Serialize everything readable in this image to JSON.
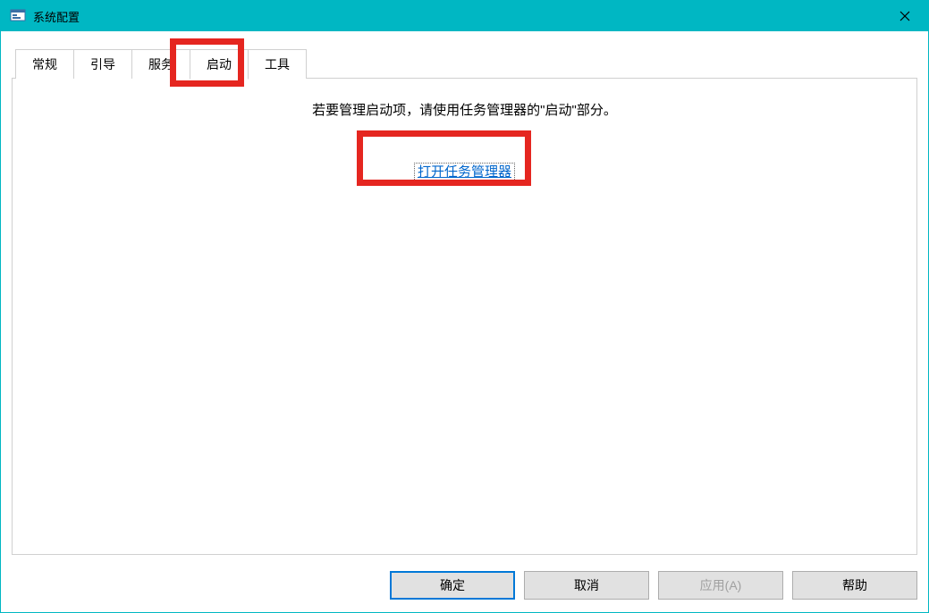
{
  "window": {
    "title": "系统配置"
  },
  "tabs": {
    "general": "常规",
    "boot": "引导",
    "services": "服务",
    "startup": "启动",
    "tools": "工具"
  },
  "panel": {
    "instruction": "若要管理启动项，请使用任务管理器的\"启动\"部分。",
    "link": "打开任务管理器"
  },
  "buttons": {
    "ok": "确定",
    "cancel": "取消",
    "apply": "应用(A)",
    "help": "帮助"
  }
}
